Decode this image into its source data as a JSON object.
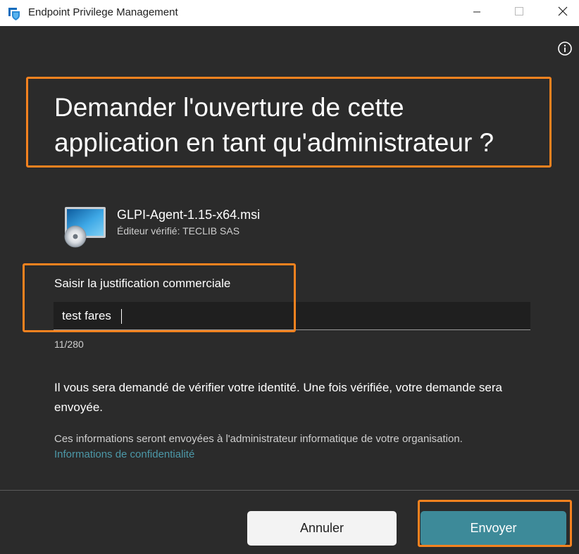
{
  "window": {
    "title": "Endpoint Privilege Management"
  },
  "colors": {
    "background": "#2b2b2b",
    "accent": "#3d8a99",
    "highlight": "#f5821f",
    "link": "#4c98a8"
  },
  "icons": {
    "app": "shield-icon",
    "minimize": "minimize-icon",
    "maximize": "maximize-icon",
    "close": "close-icon",
    "info": "info-icon",
    "file": "installer-package-icon"
  },
  "main": {
    "heading_line1": "Demander l'ouverture de cette",
    "heading_line2": "application en tant qu'administrateur ?",
    "app": {
      "file_name": "GLPI-Agent-1.15-x64.msi",
      "publisher": "Éditeur vérifié: TECLIB SAS"
    },
    "justification": {
      "label": "Saisir la justification commerciale",
      "value": "test fares",
      "counter": "11/280"
    },
    "identity_text": "Il vous sera demandé de vérifier votre identité. Une fois vérifiée, votre demande sera envoyée.",
    "info_text": "Ces informations seront envoyées à l'administrateur informatique de votre organisation.",
    "privacy_link": "Informations de confidentialité"
  },
  "footer": {
    "cancel_label": "Annuler",
    "send_label": "Envoyer"
  }
}
